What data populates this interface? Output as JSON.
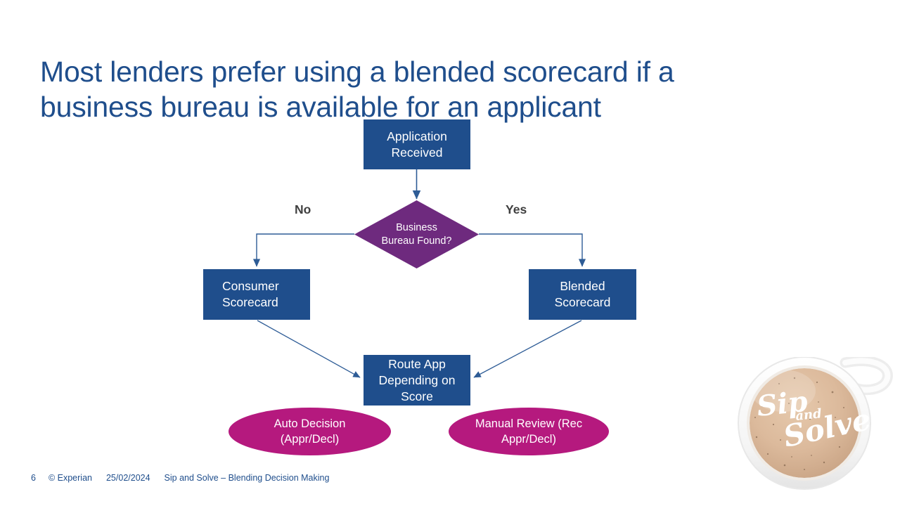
{
  "slide": {
    "title": "Most lenders prefer using a blended scorecard if a\nbusiness bureau is available for an applicant",
    "title_color": "#1F4E8C",
    "background": "#ffffff"
  },
  "palette": {
    "navy": "#1F4E8C",
    "purple": "#6E2A7E",
    "magenta": "#B5197E",
    "label_gray": "#404040",
    "connector": "#2E5C96"
  },
  "flowchart": {
    "nodes": {
      "application": {
        "label": "Application\nReceived",
        "shape": "rectangle",
        "fill": "#1F4E8C"
      },
      "decision": {
        "label": "Business\nBureau Found?",
        "shape": "diamond",
        "fill": "#6E2A7E"
      },
      "consumer": {
        "label": "Consumer\nScorecard",
        "shape": "rectangle",
        "fill": "#1F4E8C"
      },
      "blended": {
        "label": "Blended\nScorecard",
        "shape": "rectangle",
        "fill": "#1F4E8C"
      },
      "route": {
        "label": "Route App\nDepending on\nScore",
        "shape": "rectangle",
        "fill": "#1F4E8C"
      },
      "auto": {
        "label": "Auto Decision\n(Appr/Decl)",
        "shape": "ellipse",
        "fill": "#B5197E"
      },
      "manual": {
        "label": "Manual Review (Rec\nAppr/Decl)",
        "shape": "ellipse",
        "fill": "#B5197E"
      }
    },
    "branch_labels": {
      "no": "No",
      "yes": "Yes"
    }
  },
  "footer": {
    "page_number": "6",
    "copyright": "© Experian",
    "date": "25/02/2024",
    "deck_title": "Sip and Solve – Blending Decision Making"
  },
  "logo": {
    "name": "sip-and-solve-coffee-cup",
    "word_sip": "Sip",
    "word_and": "and",
    "word_solve": "Solve"
  }
}
